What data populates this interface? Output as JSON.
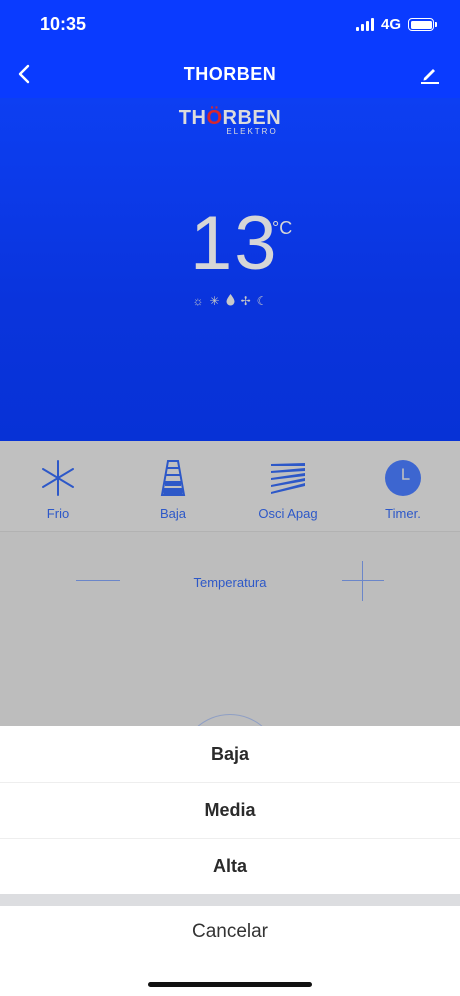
{
  "status_bar": {
    "time": "10:35",
    "network": "4G"
  },
  "nav": {
    "title": "THORBEN"
  },
  "brand": {
    "name_pre": "TH",
    "name_o": "Ö",
    "name_post": "RBEN",
    "sub": "ELEKTRO"
  },
  "display": {
    "temperature": "13",
    "unit": "°C",
    "mode_icons": [
      "☼",
      "✳",
      "💧",
      "✢",
      "☾"
    ]
  },
  "controls": [
    {
      "label": "Frio",
      "icon": "snowflake-icon"
    },
    {
      "label": "Baja",
      "icon": "fan-speed-icon"
    },
    {
      "label": "Osci Apag",
      "icon": "swing-icon"
    },
    {
      "label": "Timer.",
      "icon": "clock-icon"
    }
  ],
  "temperature_control": {
    "label": "Temperatura"
  },
  "action_sheet": {
    "options": [
      "Baja",
      "Media",
      "Alta"
    ],
    "cancel": "Cancelar"
  },
  "colors": {
    "primary_blue": "#0a3bff",
    "accent_blue": "#2d58c8",
    "brand_red": "#d8272e"
  }
}
